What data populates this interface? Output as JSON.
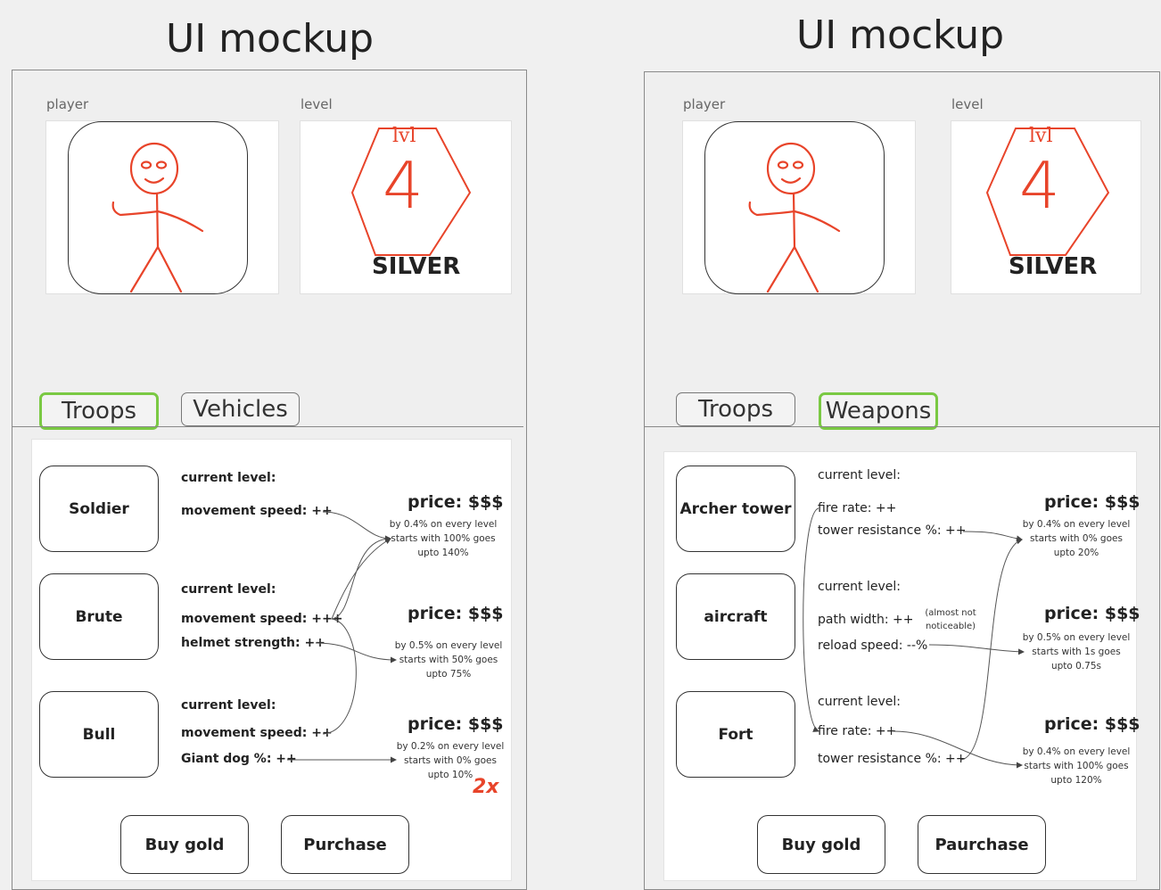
{
  "colors": {
    "accent_green": "#7ac943",
    "sketch_red": "#e8442a"
  },
  "left": {
    "title": "UI mockup",
    "player_label": "player",
    "level_label": "level",
    "level_text": "lvl",
    "level_number": "4",
    "rank": "SILVER",
    "tabs": [
      {
        "label": "Troops",
        "active": true
      },
      {
        "label": "Vehicles",
        "active": false
      }
    ],
    "items": [
      {
        "name": "Soldier",
        "stats": [
          "current level:",
          "movement speed: ++"
        ],
        "price": "price: $$$",
        "note": [
          "by 0.4% on every level",
          "starts with 100% goes",
          "upto 140%"
        ]
      },
      {
        "name": "Brute",
        "stats": [
          "current level:",
          "movement speed: +++",
          "helmet strength: ++"
        ],
        "price": "price: $$$",
        "note": [
          "by 0.5% on every level",
          "starts with 50% goes",
          "upto 75%"
        ]
      },
      {
        "name": "Bull",
        "stats": [
          "current level:",
          "movement speed: ++",
          "Giant dog %: ++"
        ],
        "price": "price: $$$",
        "note": [
          "by 0.2% on every level",
          "starts with 0% goes",
          "upto 10%"
        ]
      }
    ],
    "scribble": "2x",
    "buttons": [
      "Buy gold",
      "Purchase"
    ]
  },
  "right": {
    "title": "UI mockup",
    "player_label": "player",
    "level_label": "level",
    "level_text": "lvl",
    "level_number": "4",
    "rank": "SILVER",
    "tabs": [
      {
        "label": "Troops",
        "active": false
      },
      {
        "label": "Weapons",
        "active": true
      }
    ],
    "items": [
      {
        "name": "Archer tower",
        "stats": [
          "current level:",
          "fire rate: ++",
          "tower resistance %: ++"
        ],
        "price": "price: $$$",
        "note": [
          "by 0.4% on every level",
          "starts with 0% goes",
          "upto 20%"
        ]
      },
      {
        "name": "aircraft",
        "stats": [
          "current level:",
          "path width: ++",
          "reload speed: --%"
        ],
        "side_note": [
          "(almost not",
          "noticeable)"
        ],
        "price": "price: $$$",
        "note": [
          "by 0.5% on every level",
          "starts with 1s goes",
          "upto 0.75s"
        ]
      },
      {
        "name": "Fort",
        "stats": [
          "current level:",
          "fire rate: ++",
          "tower resistance %: ++"
        ],
        "price": "price: $$$",
        "note": [
          "by 0.4% on every level",
          "starts with 100% goes",
          "upto 120%"
        ]
      }
    ],
    "buttons": [
      "Buy gold",
      "Paurchase"
    ]
  }
}
